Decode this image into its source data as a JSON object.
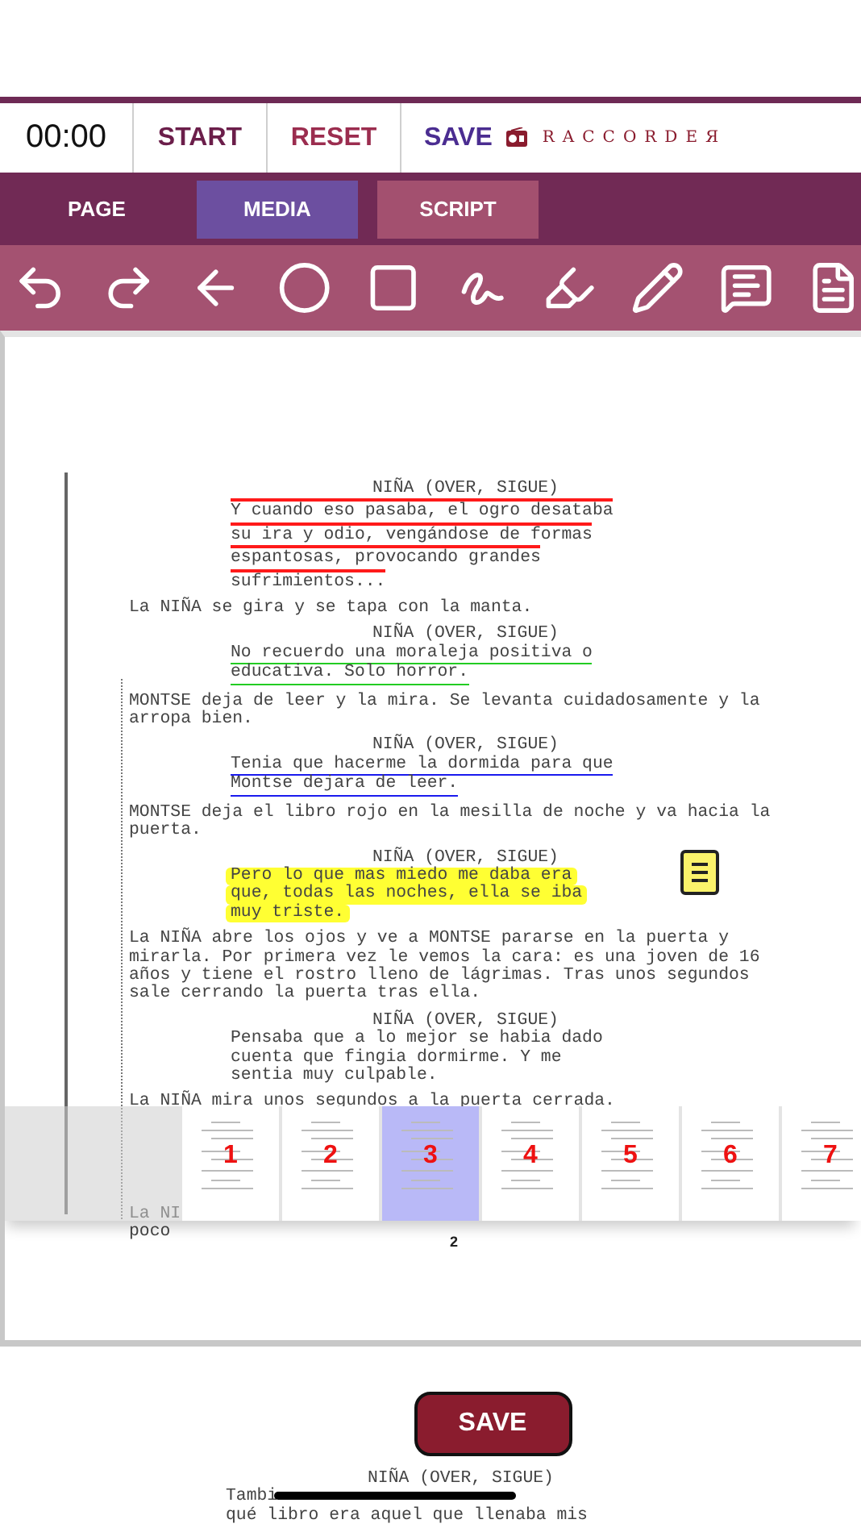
{
  "header": {
    "timer": "00:00",
    "buttons": [
      {
        "label": "START",
        "kind": "start"
      },
      {
        "label": "RESET",
        "kind": "reset"
      },
      {
        "label": "SAVE",
        "kind": "save"
      }
    ],
    "logo": "RACCORDEЯ"
  },
  "tabs": [
    {
      "label": "PAGE",
      "selected": false,
      "kind": "plain"
    },
    {
      "label": "MEDIA",
      "selected": true,
      "kind": "button"
    },
    {
      "label": "SCRIPT",
      "selected": false,
      "kind": "button"
    }
  ],
  "script": {
    "blocks": [
      {
        "kind": "character",
        "lines": [
          "NIÑA (OVER, SIGUE)"
        ],
        "struck": false,
        "underlined": false,
        "highlighted": false,
        "scribbled": false
      },
      {
        "kind": "dialogue",
        "lines": [
          "Y cuando eso pasaba, el ogro desataba",
          "su ira y odio, vengándose de formas",
          "espantosas, provocando grandes",
          "sufrimientos..."
        ],
        "struck": true,
        "underlined": false,
        "highlighted": false,
        "scribbled": false,
        "color": "#ff1a1a"
      },
      {
        "kind": "action",
        "lines": [
          "La NIÑA se gira y se tapa con la manta."
        ],
        "struck": false,
        "underlined": false,
        "highlighted": false,
        "scribbled": false
      },
      {
        "kind": "character",
        "lines": [
          "NIÑA (OVER, SIGUE)"
        ],
        "struck": false,
        "underlined": false,
        "highlighted": false,
        "scribbled": false
      },
      {
        "kind": "dialogue",
        "lines": [
          "No recuerdo una moraleja positiva o",
          "educativa. Solo horror."
        ],
        "struck": false,
        "underlined": true,
        "highlighted": false,
        "scribbled": false,
        "color": "#22cc22"
      },
      {
        "kind": "action",
        "lines": [
          "MONTSE deja de leer y la mira. Se levanta cuidadosamente y la",
          "arropa bien."
        ],
        "struck": false,
        "underlined": false,
        "highlighted": false,
        "scribbled": false
      },
      {
        "kind": "character",
        "lines": [
          "NIÑA (OVER, SIGUE)"
        ],
        "struck": false,
        "underlined": false,
        "highlighted": false,
        "scribbled": false
      },
      {
        "kind": "dialogue",
        "lines": [
          "Tenia que hacerme la dormida para que",
          "Montse dejara de leer."
        ],
        "struck": false,
        "underlined": true,
        "highlighted": false,
        "scribbled": false,
        "color": "#1a1aee"
      },
      {
        "kind": "action",
        "lines": [
          "MONTSE deja el libro rojo en la mesilla de noche y va hacia la",
          "puerta."
        ],
        "struck": false,
        "underlined": false,
        "highlighted": false,
        "scribbled": false
      },
      {
        "kind": "character",
        "lines": [
          "NIÑA (OVER, SIGUE)"
        ],
        "struck": false,
        "underlined": false,
        "highlighted": false,
        "scribbled": false
      },
      {
        "kind": "dialogue",
        "lines": [
          "Pero lo que mas miedo me daba era",
          "que, todas las noches, ella se iba",
          "muy triste."
        ],
        "struck": false,
        "underlined": false,
        "highlighted": true,
        "scribbled": false,
        "color": "#ffff33"
      },
      {
        "kind": "action",
        "lines": [
          "La NIÑA abre los ojos y ve a MONTSE pararse en la puerta y",
          "mirarla. Por primera vez le vemos la cara: es una joven de 16",
          "años y tiene el rostro lleno de lágrimas. Tras unos segundos",
          "sale cerrando la puerta tras ella."
        ],
        "struck": false,
        "underlined": false,
        "highlighted": false,
        "scribbled": false
      },
      {
        "kind": "character",
        "lines": [
          "NIÑA (OVER, SIGUE)"
        ],
        "struck": false,
        "underlined": false,
        "highlighted": false,
        "scribbled": false
      },
      {
        "kind": "dialogue",
        "lines": [
          "Pensaba que a lo mejor se habia dado",
          "cuenta que fingia dormirme. Y me",
          "sentia muy culpable."
        ],
        "struck": false,
        "underlined": false,
        "highlighted": false,
        "scribbled": false
      },
      {
        "kind": "action",
        "lines": [
          "La NIÑA mira unos segundos a la puerta cerrada."
        ],
        "struck": false,
        "underlined": false,
        "highlighted": false,
        "scribbled": false
      },
      {
        "kind": "action",
        "lines": [
          "La NI",
          "poco"
        ],
        "struck": false,
        "underlined": false,
        "highlighted": false,
        "scribbled": false
      }
    ]
  },
  "thumbnails": [
    {
      "label": "1",
      "selected": false
    },
    {
      "label": "2",
      "selected": false
    },
    {
      "label": "3",
      "selected": true
    },
    {
      "label": "4",
      "selected": false
    },
    {
      "label": "5",
      "selected": false
    },
    {
      "label": "6",
      "selected": false
    },
    {
      "label": "7",
      "selected": false
    }
  ],
  "page_number": "2",
  "save_button": "SAVE",
  "next_page": {
    "blocks": [
      {
        "kind": "character",
        "lines": [
          "NIÑA (OVER, SIGUE)"
        ],
        "struck": false,
        "underlined": false,
        "highlighted": false,
        "scribbled": false
      },
      {
        "kind": "dialogue",
        "lines": [
          "Tambi"
        ],
        "struck": false,
        "underlined": false,
        "highlighted": false,
        "scribbled": true,
        "color": "#000000"
      },
      {
        "kind": "dialogue",
        "lines": [
          "qué libro era aquel que llenaba mis"
        ],
        "struck": false,
        "underlined": false,
        "highlighted": false,
        "scribbled": false
      }
    ]
  }
}
